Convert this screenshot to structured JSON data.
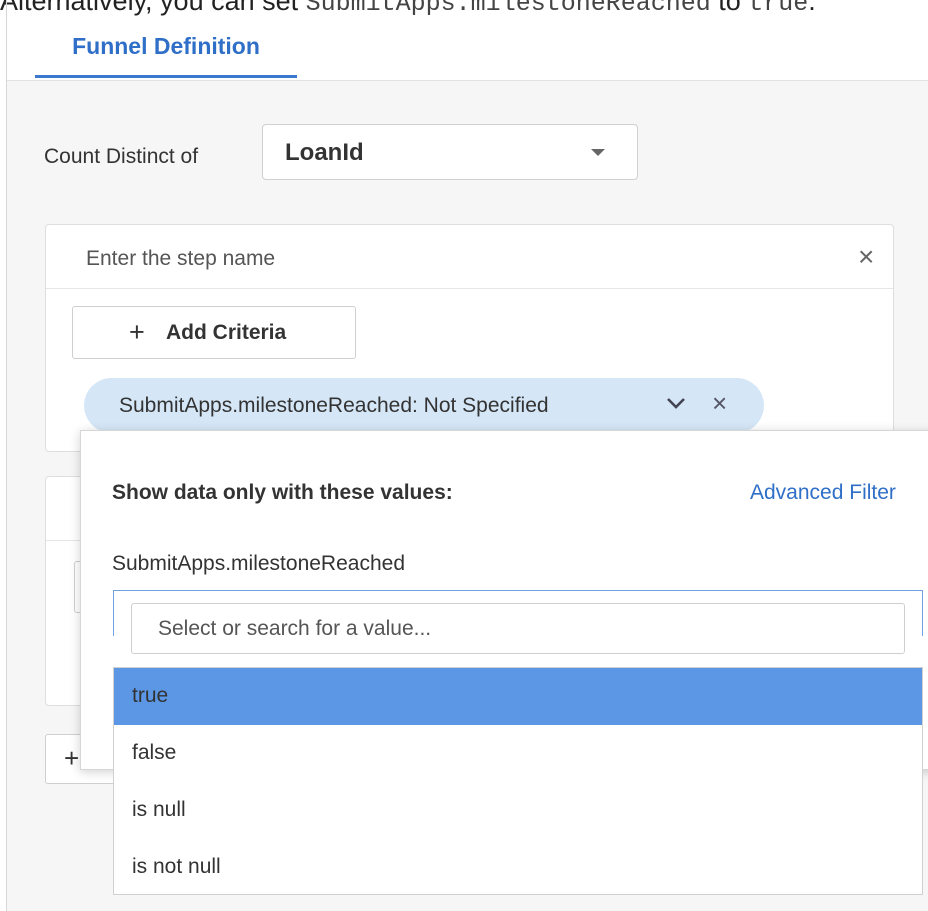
{
  "intro": {
    "prefix": "Alternatively, you can set ",
    "code1": "SubmitApps.milestoneReached",
    "middle": " to ",
    "code2": "true",
    "suffix": "."
  },
  "tabs": [
    {
      "label": "Funnel Definition",
      "active": true
    }
  ],
  "count": {
    "label": "Count Distinct of",
    "value": "LoanId"
  },
  "step": {
    "name_placeholder": "Enter the step name",
    "close_glyph": "×",
    "add_criteria_label": "Add Criteria",
    "add_glyph": "+"
  },
  "criteria_chip": {
    "label": "SubmitApps.milestoneReached: Not Specified",
    "expand_glyph": "⌄",
    "remove_glyph": "×"
  },
  "filter_popover": {
    "title": "Show data only with these values:",
    "advanced_link": "Advanced Filter",
    "field_label": "SubmitApps.milestoneReached",
    "search_placeholder": "Select or search for a value...",
    "options": [
      {
        "label": "true",
        "selected": true
      },
      {
        "label": "false",
        "selected": false
      },
      {
        "label": "is null",
        "selected": false
      },
      {
        "label": "is not null",
        "selected": false
      }
    ]
  },
  "colors": {
    "accent": "#2f6fc7",
    "chip_bg": "#d5e7f7",
    "selected_option": "#5b97e5",
    "panel_bg": "#f6f6f6"
  }
}
